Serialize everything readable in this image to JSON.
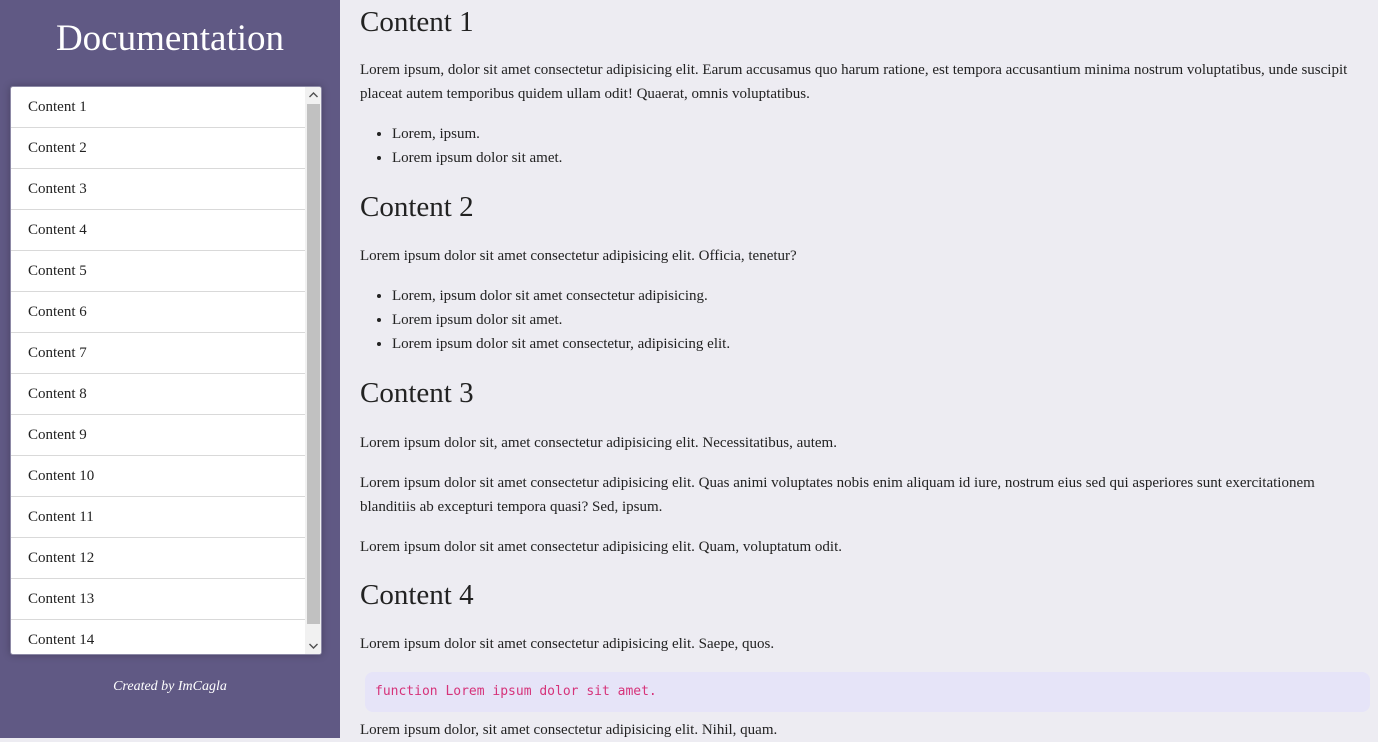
{
  "sidebar": {
    "title": "Documentation",
    "items": [
      "Content 1",
      "Content 2",
      "Content 3",
      "Content 4",
      "Content 5",
      "Content 6",
      "Content 7",
      "Content 8",
      "Content 9",
      "Content 10",
      "Content 11",
      "Content 12",
      "Content 13",
      "Content 14"
    ],
    "credit": "Created by ImCagla"
  },
  "sections": [
    {
      "title": "Content 1",
      "p1": "Lorem ipsum, dolor sit amet consectetur adipisicing elit. Earum accusamus quo harum ratione, est tempora accusantium minima nostrum voluptatibus, unde suscipit placeat autem temporibus quidem ullam odit! Quaerat, omnis voluptatibus.",
      "bullets": [
        "Lorem, ipsum.",
        "Lorem ipsum dolor sit amet."
      ]
    },
    {
      "title": "Content 2",
      "p1": "Lorem ipsum dolor sit amet consectetur adipisicing elit. Officia, tenetur?",
      "bullets": [
        "Lorem, ipsum dolor sit amet consectetur adipisicing.",
        "Lorem ipsum dolor sit amet.",
        "Lorem ipsum dolor sit amet consectetur, adipisicing elit."
      ]
    },
    {
      "title": "Content 3",
      "p1": "Lorem ipsum dolor sit, amet consectetur adipisicing elit. Necessitatibus, autem.",
      "p2": "Lorem ipsum dolor sit amet consectetur adipisicing elit. Quas animi voluptates nobis enim aliquam id iure, nostrum eius sed qui asperiores sunt exercitationem blanditiis ab excepturi tempora quasi? Sed, ipsum.",
      "p3": "Lorem ipsum dolor sit amet consectetur adipisicing elit. Quam, voluptatum odit."
    },
    {
      "title": "Content 4",
      "p1": "Lorem ipsum dolor sit amet consectetur adipisicing elit. Saepe, quos.",
      "code": "function Lorem ipsum dolor sit amet.",
      "p2": "Lorem ipsum dolor, sit amet consectetur adipisicing elit. Nihil, quam."
    }
  ]
}
